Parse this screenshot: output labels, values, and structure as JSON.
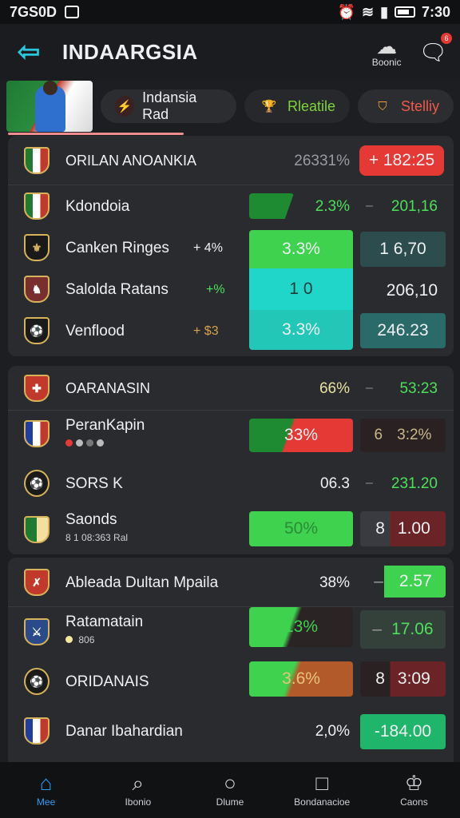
{
  "status_bar": {
    "time_left": "7GS0D",
    "time_right": "7:30"
  },
  "header": {
    "title": "INDAARGSIA",
    "action_label": "Boonic",
    "notification_count": "6"
  },
  "filters": [
    {
      "label": "Indansia Rad",
      "icon": "lightning-icon"
    },
    {
      "label": "Rleatile",
      "icon": "trophy-icon"
    },
    {
      "label": "Stelliy",
      "icon": "shield-icon"
    }
  ],
  "card1": {
    "header": {
      "name": "ORILAN ANOANKIA",
      "pct": "26331%",
      "value": "+ 182:25"
    },
    "rows": [
      {
        "name": "Kdondoia",
        "pct": "2.3%",
        "value": "201,16"
      },
      {
        "name": "Canken Ringes",
        "mid": "+ 4%",
        "pct": "3.3%",
        "value": "1  6,70"
      },
      {
        "name": "Salolda Ratans",
        "mid": "+%",
        "pct": "1  0",
        "value": "206,10"
      },
      {
        "name": "Venflood",
        "mid": "+ $3",
        "pct": "3.3%",
        "value": "246.23"
      }
    ]
  },
  "card2": {
    "header": {
      "name": "OARANASIN",
      "pct": "66%",
      "value": "53:23"
    },
    "rows": [
      {
        "name": "PeranKapin",
        "pct": "33%",
        "value": "3:2%",
        "prefix": "6"
      },
      {
        "name": "SORS    K",
        "pct": "06.3",
        "value": "231.20"
      },
      {
        "name": "Saonds",
        "sub": "8 1 08:363 Ral",
        "pct": "50%",
        "value": "1.00",
        "prefix": "8"
      }
    ]
  },
  "card3": {
    "rows": [
      {
        "name": "Ableada Dultan Mpaila",
        "pct": "38%",
        "value": "2.57"
      },
      {
        "name": "Ratamatain",
        "sub": "806",
        "pct": "13%",
        "value": "17.06"
      },
      {
        "name": "ORIDANAIS",
        "pct": "3.6%",
        "value": "3:09",
        "prefix": "8"
      },
      {
        "name": "Danar Ibahardian",
        "pct": "2,0%",
        "value": "-184.00"
      }
    ]
  },
  "nav": [
    {
      "label": "Mee",
      "icon": "home-icon",
      "active": true
    },
    {
      "label": "Ibonio",
      "icon": "search-icon"
    },
    {
      "label": "Dlume",
      "icon": "circle-icon"
    },
    {
      "label": "Bondanacioe",
      "icon": "square-icon"
    },
    {
      "label": "Caons",
      "icon": "trophy-icon"
    }
  ],
  "colors": {
    "accent": "#27c6d9",
    "green": "#3fd24f",
    "red": "#e53935",
    "teal": "#1fd6c8",
    "bg": "#1d1e21"
  }
}
